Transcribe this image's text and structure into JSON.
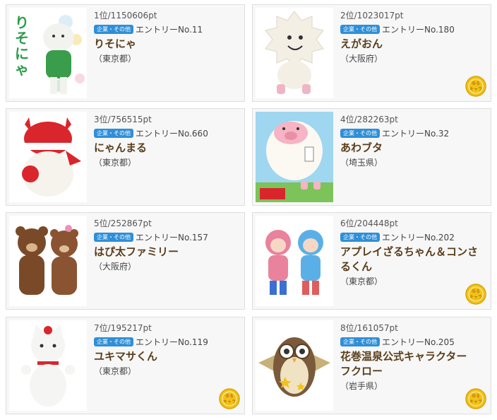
{
  "category_badge": "企業・その他",
  "entries": [
    {
      "rank": "1位/1150606pt",
      "entry": "エントリーNo.11",
      "name": "りそにゃ",
      "pref": "（東京都）",
      "medal": false
    },
    {
      "rank": "2位/1023017pt",
      "entry": "エントリーNo.180",
      "name": "えがおん",
      "pref": "（大阪府）",
      "medal": true
    },
    {
      "rank": "3位/756515pt",
      "entry": "エントリーNo.660",
      "name": "にゃんまる",
      "pref": "（東京都）",
      "medal": false
    },
    {
      "rank": "4位/282263pt",
      "entry": "エントリーNo.32",
      "name": "あわブタ",
      "pref": "（埼玉県）",
      "medal": false
    },
    {
      "rank": "5位/252867pt",
      "entry": "エントリーNo.157",
      "name": "はぴ太ファミリー",
      "pref": "（大阪府）",
      "medal": false
    },
    {
      "rank": "6位/204448pt",
      "entry": "エントリーNo.202",
      "name": "アプレイざるちゃん＆コンさるくん",
      "pref": "（東京都）",
      "medal": true
    },
    {
      "rank": "7位/195217pt",
      "entry": "エントリーNo.119",
      "name": "ユキマサくん",
      "pref": "（東京都）",
      "medal": true
    },
    {
      "rank": "8位/161057pt",
      "entry": "エントリーNo.205",
      "name": "花巻温泉公式キャラクター　フクロー",
      "pref": "（岩手県）",
      "medal": true
    }
  ],
  "colors": {
    "badge": "#2f8fd8",
    "name": "#5a3e1b",
    "medal": "#f2c21b",
    "card_bg": "#f7f7f7"
  }
}
